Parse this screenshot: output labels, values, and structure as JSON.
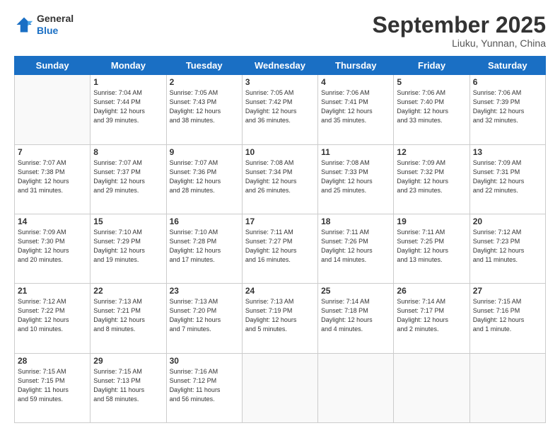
{
  "header": {
    "logo_line1": "General",
    "logo_line2": "Blue",
    "month": "September 2025",
    "location": "Liuku, Yunnan, China"
  },
  "days_of_week": [
    "Sunday",
    "Monday",
    "Tuesday",
    "Wednesday",
    "Thursday",
    "Friday",
    "Saturday"
  ],
  "weeks": [
    [
      {
        "day": "",
        "info": ""
      },
      {
        "day": "1",
        "info": "Sunrise: 7:04 AM\nSunset: 7:44 PM\nDaylight: 12 hours\nand 39 minutes."
      },
      {
        "day": "2",
        "info": "Sunrise: 7:05 AM\nSunset: 7:43 PM\nDaylight: 12 hours\nand 38 minutes."
      },
      {
        "day": "3",
        "info": "Sunrise: 7:05 AM\nSunset: 7:42 PM\nDaylight: 12 hours\nand 36 minutes."
      },
      {
        "day": "4",
        "info": "Sunrise: 7:06 AM\nSunset: 7:41 PM\nDaylight: 12 hours\nand 35 minutes."
      },
      {
        "day": "5",
        "info": "Sunrise: 7:06 AM\nSunset: 7:40 PM\nDaylight: 12 hours\nand 33 minutes."
      },
      {
        "day": "6",
        "info": "Sunrise: 7:06 AM\nSunset: 7:39 PM\nDaylight: 12 hours\nand 32 minutes."
      }
    ],
    [
      {
        "day": "7",
        "info": "Sunrise: 7:07 AM\nSunset: 7:38 PM\nDaylight: 12 hours\nand 31 minutes."
      },
      {
        "day": "8",
        "info": "Sunrise: 7:07 AM\nSunset: 7:37 PM\nDaylight: 12 hours\nand 29 minutes."
      },
      {
        "day": "9",
        "info": "Sunrise: 7:07 AM\nSunset: 7:36 PM\nDaylight: 12 hours\nand 28 minutes."
      },
      {
        "day": "10",
        "info": "Sunrise: 7:08 AM\nSunset: 7:34 PM\nDaylight: 12 hours\nand 26 minutes."
      },
      {
        "day": "11",
        "info": "Sunrise: 7:08 AM\nSunset: 7:33 PM\nDaylight: 12 hours\nand 25 minutes."
      },
      {
        "day": "12",
        "info": "Sunrise: 7:09 AM\nSunset: 7:32 PM\nDaylight: 12 hours\nand 23 minutes."
      },
      {
        "day": "13",
        "info": "Sunrise: 7:09 AM\nSunset: 7:31 PM\nDaylight: 12 hours\nand 22 minutes."
      }
    ],
    [
      {
        "day": "14",
        "info": "Sunrise: 7:09 AM\nSunset: 7:30 PM\nDaylight: 12 hours\nand 20 minutes."
      },
      {
        "day": "15",
        "info": "Sunrise: 7:10 AM\nSunset: 7:29 PM\nDaylight: 12 hours\nand 19 minutes."
      },
      {
        "day": "16",
        "info": "Sunrise: 7:10 AM\nSunset: 7:28 PM\nDaylight: 12 hours\nand 17 minutes."
      },
      {
        "day": "17",
        "info": "Sunrise: 7:11 AM\nSunset: 7:27 PM\nDaylight: 12 hours\nand 16 minutes."
      },
      {
        "day": "18",
        "info": "Sunrise: 7:11 AM\nSunset: 7:26 PM\nDaylight: 12 hours\nand 14 minutes."
      },
      {
        "day": "19",
        "info": "Sunrise: 7:11 AM\nSunset: 7:25 PM\nDaylight: 12 hours\nand 13 minutes."
      },
      {
        "day": "20",
        "info": "Sunrise: 7:12 AM\nSunset: 7:23 PM\nDaylight: 12 hours\nand 11 minutes."
      }
    ],
    [
      {
        "day": "21",
        "info": "Sunrise: 7:12 AM\nSunset: 7:22 PM\nDaylight: 12 hours\nand 10 minutes."
      },
      {
        "day": "22",
        "info": "Sunrise: 7:13 AM\nSunset: 7:21 PM\nDaylight: 12 hours\nand 8 minutes."
      },
      {
        "day": "23",
        "info": "Sunrise: 7:13 AM\nSunset: 7:20 PM\nDaylight: 12 hours\nand 7 minutes."
      },
      {
        "day": "24",
        "info": "Sunrise: 7:13 AM\nSunset: 7:19 PM\nDaylight: 12 hours\nand 5 minutes."
      },
      {
        "day": "25",
        "info": "Sunrise: 7:14 AM\nSunset: 7:18 PM\nDaylight: 12 hours\nand 4 minutes."
      },
      {
        "day": "26",
        "info": "Sunrise: 7:14 AM\nSunset: 7:17 PM\nDaylight: 12 hours\nand 2 minutes."
      },
      {
        "day": "27",
        "info": "Sunrise: 7:15 AM\nSunset: 7:16 PM\nDaylight: 12 hours\nand 1 minute."
      }
    ],
    [
      {
        "day": "28",
        "info": "Sunrise: 7:15 AM\nSunset: 7:15 PM\nDaylight: 11 hours\nand 59 minutes."
      },
      {
        "day": "29",
        "info": "Sunrise: 7:15 AM\nSunset: 7:13 PM\nDaylight: 11 hours\nand 58 minutes."
      },
      {
        "day": "30",
        "info": "Sunrise: 7:16 AM\nSunset: 7:12 PM\nDaylight: 11 hours\nand 56 minutes."
      },
      {
        "day": "",
        "info": ""
      },
      {
        "day": "",
        "info": ""
      },
      {
        "day": "",
        "info": ""
      },
      {
        "day": "",
        "info": ""
      }
    ]
  ]
}
